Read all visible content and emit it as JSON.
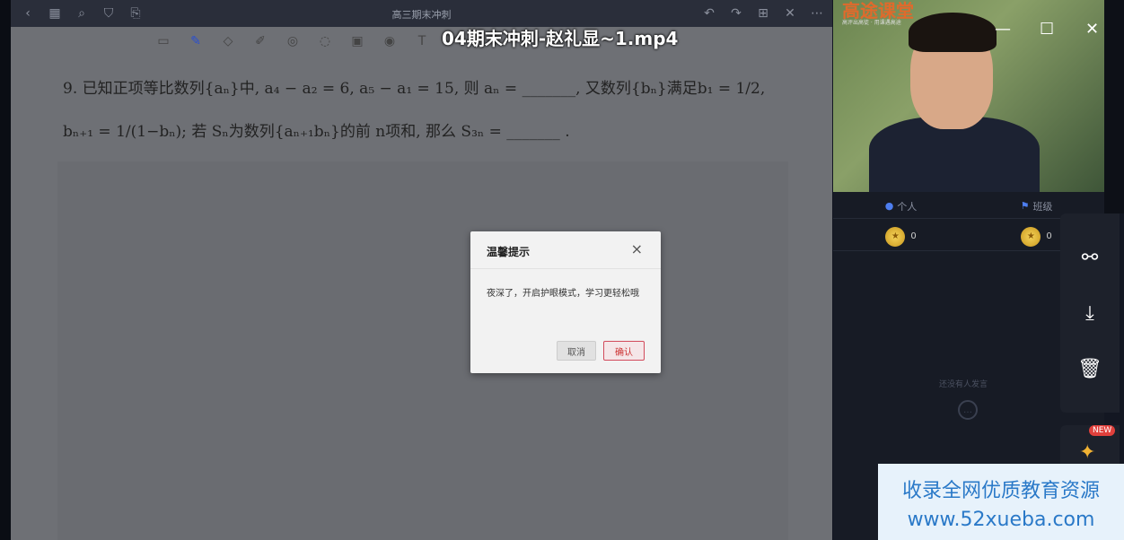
{
  "topbar": {
    "title": "高三期末冲刺",
    "left_icons": [
      "back-icon",
      "grid-icon",
      "search-icon",
      "bookmark-icon",
      "share-doc-icon"
    ],
    "right_icons": [
      "undo-icon",
      "redo-icon",
      "export-icon",
      "close-icon",
      "more-icon"
    ]
  },
  "video_title": "04期末冲刺-赵礼显~1.mp4",
  "problem": {
    "line1": "9.  已知正项等比数列{aₙ}中, a₄ − a₂ = 6, a₅ − a₁ = 15, 则 aₙ = _______, 又数列{bₙ}满足b₁ = 1/2,",
    "line2": "bₙ₊₁ = 1/(1−bₙ);  若 Sₙ为数列{aₙ₊₁bₙ}的前 n项和,  那么 S₃ₙ = _______ ."
  },
  "dialog": {
    "title": "温馨提示",
    "close": "×",
    "body": "夜深了，开启护眼模式，学习更轻松哦",
    "cancel": "取消",
    "confirm": "确认"
  },
  "panel": {
    "brand": "高途课堂",
    "brand_sub": "高评出高徒 · 用课遇高途",
    "tabs": [
      {
        "label": "个人",
        "icon": "person-icon"
      },
      {
        "label": "班级",
        "icon": "flag-icon"
      }
    ],
    "scores": [
      "0",
      "0"
    ],
    "empty_text": "还没有人发言",
    "window_controls": [
      "—",
      "☐",
      "✕"
    ]
  },
  "fab": {
    "icons": [
      "share-icon",
      "download-icon",
      "trash-icon"
    ],
    "new_badge": "NEW"
  },
  "watermark": {
    "line1": "收录全网优质教育资源",
    "line2": "www.52xueba.com"
  },
  "colors": {
    "accent_red": "#d24b5c",
    "tab_blue": "#4d7ef0",
    "watermark_blue": "#2a79c8"
  }
}
